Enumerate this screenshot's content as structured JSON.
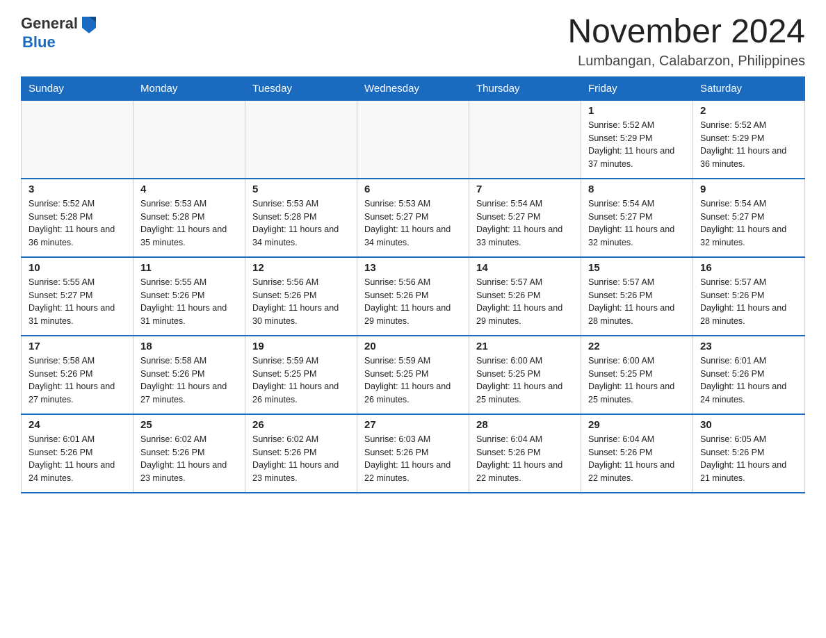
{
  "logo": {
    "general": "General",
    "blue": "Blue"
  },
  "title": "November 2024",
  "subtitle": "Lumbangan, Calabarzon, Philippines",
  "days_of_week": [
    "Sunday",
    "Monday",
    "Tuesday",
    "Wednesday",
    "Thursday",
    "Friday",
    "Saturday"
  ],
  "weeks": [
    [
      {
        "day": "",
        "info": ""
      },
      {
        "day": "",
        "info": ""
      },
      {
        "day": "",
        "info": ""
      },
      {
        "day": "",
        "info": ""
      },
      {
        "day": "",
        "info": ""
      },
      {
        "day": "1",
        "info": "Sunrise: 5:52 AM\nSunset: 5:29 PM\nDaylight: 11 hours and 37 minutes."
      },
      {
        "day": "2",
        "info": "Sunrise: 5:52 AM\nSunset: 5:29 PM\nDaylight: 11 hours and 36 minutes."
      }
    ],
    [
      {
        "day": "3",
        "info": "Sunrise: 5:52 AM\nSunset: 5:28 PM\nDaylight: 11 hours and 36 minutes."
      },
      {
        "day": "4",
        "info": "Sunrise: 5:53 AM\nSunset: 5:28 PM\nDaylight: 11 hours and 35 minutes."
      },
      {
        "day": "5",
        "info": "Sunrise: 5:53 AM\nSunset: 5:28 PM\nDaylight: 11 hours and 34 minutes."
      },
      {
        "day": "6",
        "info": "Sunrise: 5:53 AM\nSunset: 5:27 PM\nDaylight: 11 hours and 34 minutes."
      },
      {
        "day": "7",
        "info": "Sunrise: 5:54 AM\nSunset: 5:27 PM\nDaylight: 11 hours and 33 minutes."
      },
      {
        "day": "8",
        "info": "Sunrise: 5:54 AM\nSunset: 5:27 PM\nDaylight: 11 hours and 32 minutes."
      },
      {
        "day": "9",
        "info": "Sunrise: 5:54 AM\nSunset: 5:27 PM\nDaylight: 11 hours and 32 minutes."
      }
    ],
    [
      {
        "day": "10",
        "info": "Sunrise: 5:55 AM\nSunset: 5:27 PM\nDaylight: 11 hours and 31 minutes."
      },
      {
        "day": "11",
        "info": "Sunrise: 5:55 AM\nSunset: 5:26 PM\nDaylight: 11 hours and 31 minutes."
      },
      {
        "day": "12",
        "info": "Sunrise: 5:56 AM\nSunset: 5:26 PM\nDaylight: 11 hours and 30 minutes."
      },
      {
        "day": "13",
        "info": "Sunrise: 5:56 AM\nSunset: 5:26 PM\nDaylight: 11 hours and 29 minutes."
      },
      {
        "day": "14",
        "info": "Sunrise: 5:57 AM\nSunset: 5:26 PM\nDaylight: 11 hours and 29 minutes."
      },
      {
        "day": "15",
        "info": "Sunrise: 5:57 AM\nSunset: 5:26 PM\nDaylight: 11 hours and 28 minutes."
      },
      {
        "day": "16",
        "info": "Sunrise: 5:57 AM\nSunset: 5:26 PM\nDaylight: 11 hours and 28 minutes."
      }
    ],
    [
      {
        "day": "17",
        "info": "Sunrise: 5:58 AM\nSunset: 5:26 PM\nDaylight: 11 hours and 27 minutes."
      },
      {
        "day": "18",
        "info": "Sunrise: 5:58 AM\nSunset: 5:26 PM\nDaylight: 11 hours and 27 minutes."
      },
      {
        "day": "19",
        "info": "Sunrise: 5:59 AM\nSunset: 5:25 PM\nDaylight: 11 hours and 26 minutes."
      },
      {
        "day": "20",
        "info": "Sunrise: 5:59 AM\nSunset: 5:25 PM\nDaylight: 11 hours and 26 minutes."
      },
      {
        "day": "21",
        "info": "Sunrise: 6:00 AM\nSunset: 5:25 PM\nDaylight: 11 hours and 25 minutes."
      },
      {
        "day": "22",
        "info": "Sunrise: 6:00 AM\nSunset: 5:25 PM\nDaylight: 11 hours and 25 minutes."
      },
      {
        "day": "23",
        "info": "Sunrise: 6:01 AM\nSunset: 5:26 PM\nDaylight: 11 hours and 24 minutes."
      }
    ],
    [
      {
        "day": "24",
        "info": "Sunrise: 6:01 AM\nSunset: 5:26 PM\nDaylight: 11 hours and 24 minutes."
      },
      {
        "day": "25",
        "info": "Sunrise: 6:02 AM\nSunset: 5:26 PM\nDaylight: 11 hours and 23 minutes."
      },
      {
        "day": "26",
        "info": "Sunrise: 6:02 AM\nSunset: 5:26 PM\nDaylight: 11 hours and 23 minutes."
      },
      {
        "day": "27",
        "info": "Sunrise: 6:03 AM\nSunset: 5:26 PM\nDaylight: 11 hours and 22 minutes."
      },
      {
        "day": "28",
        "info": "Sunrise: 6:04 AM\nSunset: 5:26 PM\nDaylight: 11 hours and 22 minutes."
      },
      {
        "day": "29",
        "info": "Sunrise: 6:04 AM\nSunset: 5:26 PM\nDaylight: 11 hours and 22 minutes."
      },
      {
        "day": "30",
        "info": "Sunrise: 6:05 AM\nSunset: 5:26 PM\nDaylight: 11 hours and 21 minutes."
      }
    ]
  ]
}
